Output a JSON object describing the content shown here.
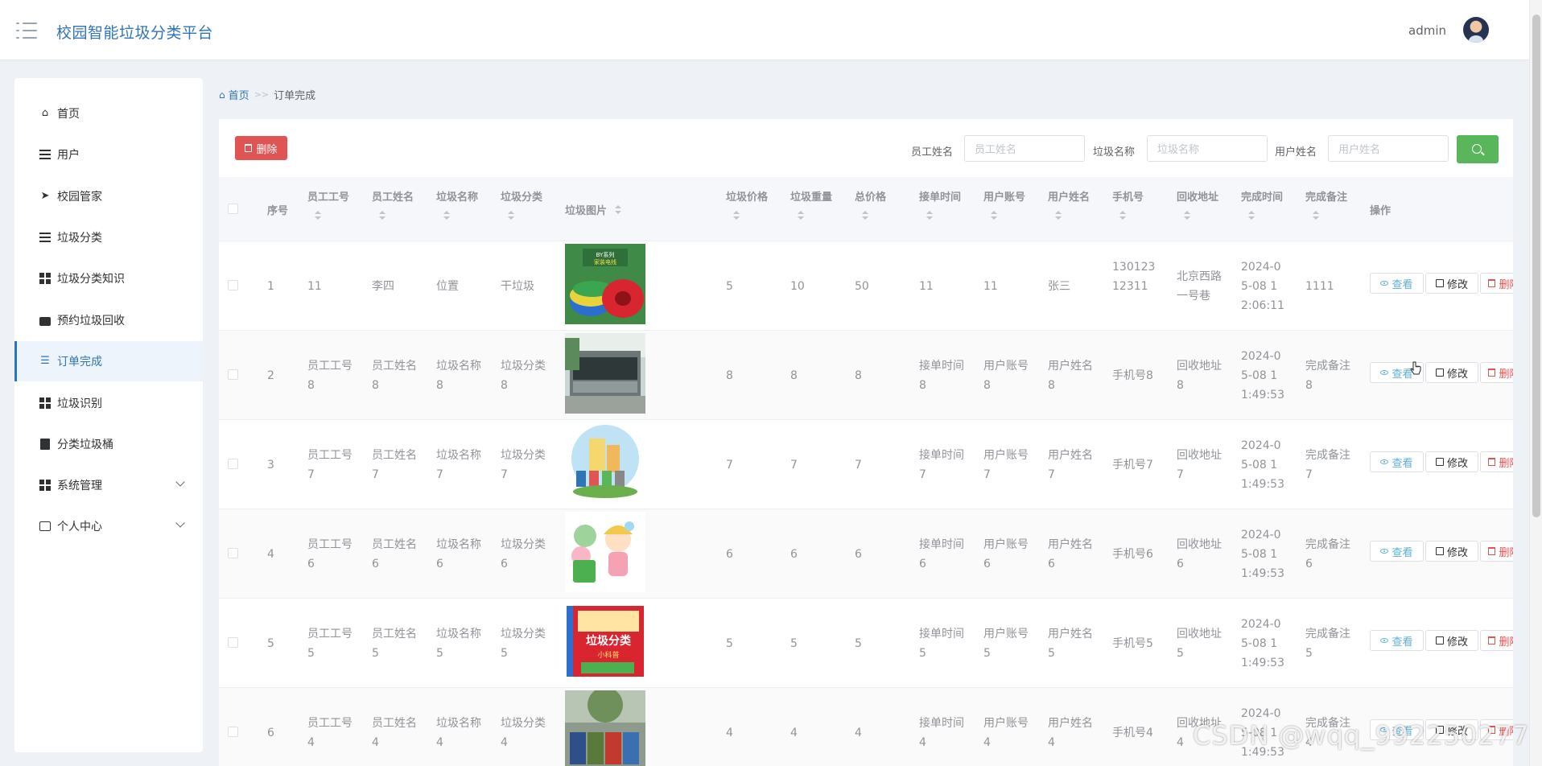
{
  "header": {
    "app_title": "校园智能垃圾分类平台",
    "user_name": "admin"
  },
  "sidebar": {
    "items": [
      {
        "label": "首页",
        "icon": "home-icon",
        "active": false
      },
      {
        "label": "用户",
        "icon": "list-icon",
        "active": false
      },
      {
        "label": "校园管家",
        "icon": "send-icon",
        "active": false
      },
      {
        "label": "垃圾分类",
        "icon": "list-icon",
        "active": false
      },
      {
        "label": "垃圾分类知识",
        "icon": "grid-icon",
        "active": false
      },
      {
        "label": "预约垃圾回收",
        "icon": "briefcase-icon",
        "active": false
      },
      {
        "label": "订单完成",
        "icon": "sliders-icon",
        "active": true
      },
      {
        "label": "垃圾识别",
        "icon": "grid-icon",
        "active": false
      },
      {
        "label": "分类垃圾桶",
        "icon": "clipboard-icon",
        "active": false
      },
      {
        "label": "系统管理",
        "icon": "grid-icon",
        "active": false,
        "expandable": true
      },
      {
        "label": "个人中心",
        "icon": "wallet-icon",
        "active": false,
        "expandable": true
      }
    ]
  },
  "breadcrumb": {
    "home": "首页",
    "separator": ">>",
    "current": "订单完成"
  },
  "toolbar": {
    "delete_label": "删除",
    "filters": [
      {
        "label": "员工姓名",
        "placeholder": "员工姓名"
      },
      {
        "label": "垃圾名称",
        "placeholder": "垃圾名称"
      },
      {
        "label": "用户姓名",
        "placeholder": "用户姓名"
      }
    ]
  },
  "table": {
    "headers": {
      "index": "序号",
      "staff_no": "员工工号",
      "staff_name": "员工姓名",
      "trash_name": "垃圾名称",
      "trash_category": "垃圾分类",
      "trash_image": "垃圾图片",
      "trash_price": "垃圾价格",
      "trash_weight": "垃圾重量",
      "total_price": "总价格",
      "accept_time": "接单时间",
      "user_account": "用户账号",
      "user_name": "用户姓名",
      "phone": "手机号",
      "address": "回收地址",
      "finish_time": "完成时间",
      "finish_note": "完成备注",
      "actions": "操作"
    },
    "rows": [
      {
        "index": "1",
        "staff_no": "11",
        "staff_name": "李四",
        "trash_name": "位置",
        "trash_category": "干垃圾",
        "price": "5",
        "weight": "10",
        "total": "50",
        "accept_time": "11",
        "user_account": "11",
        "user_name": "张三",
        "phone": "13012312311",
        "address": "北京西路一号巷",
        "finish_time": "2024-05-08 12:06:11",
        "finish_note": "1111",
        "image": "wire-spools"
      },
      {
        "index": "2",
        "staff_no": "员工工号8",
        "staff_name": "员工姓名8",
        "trash_name": "垃圾名称8",
        "trash_category": "垃圾分类8",
        "price": "8",
        "weight": "8",
        "total": "8",
        "accept_time": "接单时间8",
        "user_account": "用户账号8",
        "user_name": "用户姓名8",
        "phone": "手机号8",
        "address": "回收地址8",
        "finish_time": "2024-05-08 11:49:53",
        "finish_note": "完成备注8",
        "image": "recycling-station"
      },
      {
        "index": "3",
        "staff_no": "员工工号7",
        "staff_name": "员工姓名7",
        "trash_name": "垃圾名称7",
        "trash_category": "垃圾分类7",
        "price": "7",
        "weight": "7",
        "total": "7",
        "accept_time": "接单时间7",
        "user_account": "用户账号7",
        "user_name": "用户姓名7",
        "phone": "手机号7",
        "address": "回收地址7",
        "finish_time": "2024-05-08 11:49:53",
        "finish_note": "完成备注7",
        "image": "city-bins"
      },
      {
        "index": "4",
        "staff_no": "员工工号6",
        "staff_name": "员工姓名6",
        "trash_name": "垃圾名称6",
        "trash_category": "垃圾分类6",
        "price": "6",
        "weight": "6",
        "total": "6",
        "accept_time": "接单时间6",
        "user_account": "用户账号6",
        "user_name": "用户姓名6",
        "phone": "手机号6",
        "address": "回收地址6",
        "finish_time": "2024-05-08 11:49:53",
        "finish_note": "完成备注6",
        "image": "girl-bin"
      },
      {
        "index": "5",
        "staff_no": "员工工号5",
        "staff_name": "员工姓名5",
        "trash_name": "垃圾名称5",
        "trash_category": "垃圾分类5",
        "price": "5",
        "weight": "5",
        "total": "5",
        "accept_time": "接单时间5",
        "user_account": "用户账号5",
        "user_name": "用户姓名5",
        "phone": "手机号5",
        "address": "回收地址5",
        "finish_time": "2024-05-08 11:49:53",
        "finish_note": "完成备注5",
        "image": "book-set"
      },
      {
        "index": "6",
        "staff_no": "员工工号4",
        "staff_name": "员工姓名4",
        "trash_name": "垃圾名称4",
        "trash_category": "垃圾分类4",
        "price": "4",
        "weight": "4",
        "total": "4",
        "accept_time": "接单时间4",
        "user_account": "用户账号4",
        "user_name": "用户姓名4",
        "phone": "手机号4",
        "address": "回收地址4",
        "finish_time": "2024-05-08 11:49:53",
        "finish_note": "完成备注4",
        "image": "outdoor-bins"
      }
    ],
    "actions": {
      "view": "查看",
      "edit": "修改",
      "delete": "删除"
    }
  },
  "watermark": "CSDN @wqq_992250277",
  "colors": {
    "primary": "#2f74b5",
    "danger": "#e15454",
    "success": "#5ab65a",
    "info": "#5bb0d8"
  }
}
